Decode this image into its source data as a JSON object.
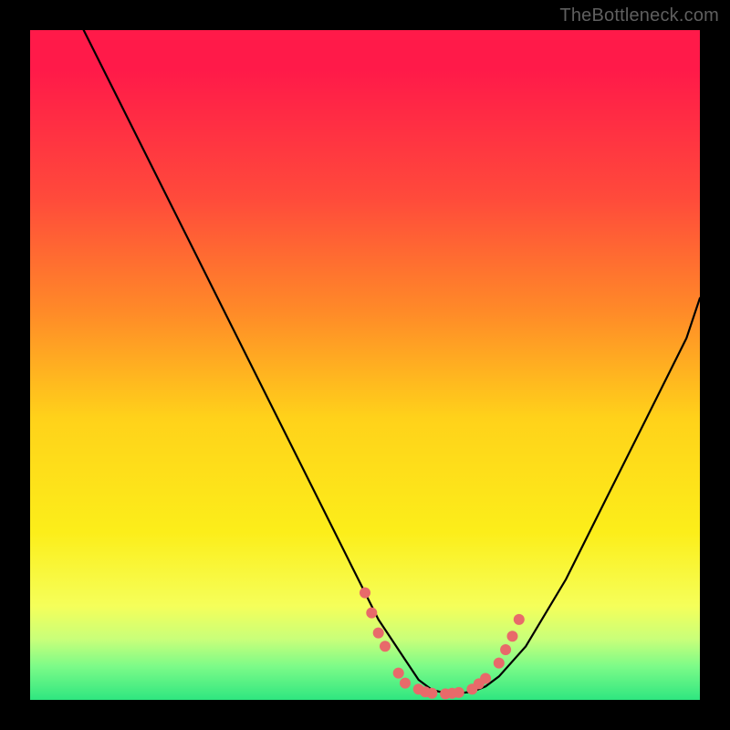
{
  "watermark": "TheBottleneck.com",
  "chart_data": {
    "type": "line",
    "title": "",
    "xlabel": "",
    "ylabel": "",
    "xlim": [
      0,
      100
    ],
    "ylim": [
      0,
      100
    ],
    "grid": false,
    "legend": false,
    "series": [
      {
        "name": "curve",
        "x": [
          8,
          12,
          18,
          24,
          30,
          36,
          42,
          48,
          52,
          56,
          58,
          60,
          62,
          64,
          66,
          68,
          70,
          74,
          80,
          86,
          92,
          98,
          100
        ],
        "y": [
          100,
          92,
          80,
          68,
          56,
          44,
          32,
          20,
          12,
          6,
          3,
          1.5,
          1,
          1,
          1.2,
          2,
          3.5,
          8,
          18,
          30,
          42,
          54,
          60
        ]
      }
    ],
    "markers": {
      "name": "dots",
      "color": "#e86a6a",
      "radius_px": 6,
      "x": [
        50,
        51,
        52,
        53,
        55,
        56,
        58,
        59,
        60,
        62,
        63,
        64,
        66,
        67,
        68,
        70,
        71,
        72,
        73
      ],
      "y": [
        16,
        13,
        10,
        8,
        4,
        2.5,
        1.6,
        1.2,
        1.0,
        0.9,
        1.0,
        1.1,
        1.6,
        2.4,
        3.2,
        5.5,
        7.5,
        9.5,
        12
      ]
    }
  }
}
